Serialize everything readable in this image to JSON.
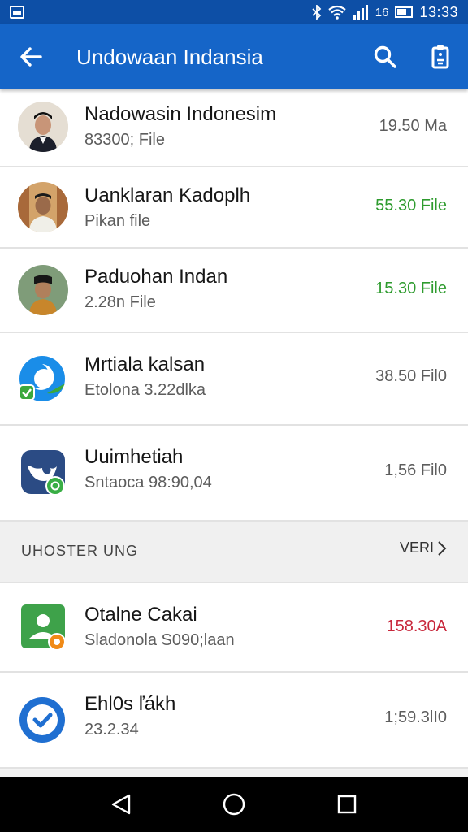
{
  "status_bar": {
    "time": "13:33",
    "signal_text": "16",
    "icons": [
      "image-icon",
      "bluetooth-icon",
      "wifi-icon",
      "signal-icon",
      "battery-icon"
    ]
  },
  "app_bar": {
    "title": "Undowaan Indansia",
    "color": "#1565c8",
    "icons": [
      "back-arrow-icon",
      "search-icon",
      "clipboard-icon"
    ]
  },
  "items": [
    {
      "title": "Nadowasin Indonesim",
      "subtitle": "83300; File",
      "meta": "19.50 Ma",
      "meta_color": "#5d5d5d",
      "avatar": "person-photo-1"
    },
    {
      "title": "Uanklaran Kadoplh",
      "subtitle": "Pikan file",
      "meta": "55.30 File",
      "meta_color": "#2e9b2e",
      "avatar": "person-photo-2"
    },
    {
      "title": "Paduohan Indan",
      "subtitle": "2.28n File",
      "meta": "15.30 File",
      "meta_color": "#2e9b2e",
      "avatar": "person-photo-3"
    },
    {
      "title": "Mrtiala kalsan",
      "subtitle": "Etolona 3.22dlka",
      "meta": "38.50 Fil0",
      "meta_color": "#5d5d5d",
      "avatar": "chat-app-icon"
    },
    {
      "title": "Uuimhetiah",
      "subtitle": "Sntaoca 98:90,04",
      "meta": "1,56 Fil0",
      "meta_color": "#5d5d5d",
      "avatar": "bird-app-icon"
    }
  ],
  "section": {
    "title": "UHOSTER UNG",
    "link": "VERI"
  },
  "items2": [
    {
      "title": "Otalne Cakai",
      "subtitle": "Sladonola S090;laan",
      "meta": "158.30A",
      "meta_color": "#c8283c",
      "avatar": "photo-app-icon"
    },
    {
      "title": "Ehl0s ľákh",
      "subtitle": "23.2.34",
      "meta": "1;59.3lI0",
      "meta_color": "#5d5d5d",
      "avatar": "check-app-icon"
    }
  ],
  "nav_bar": {
    "icons": [
      "nav-back-icon",
      "nav-home-icon",
      "nav-recents-icon"
    ]
  }
}
